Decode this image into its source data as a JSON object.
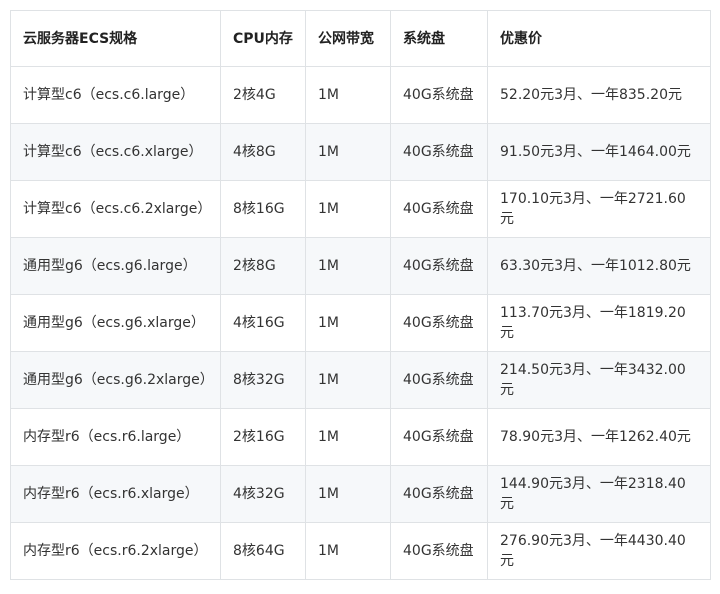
{
  "headers": [
    "云服务器ECS规格",
    "CPU内存",
    "公网带宽",
    "系统盘",
    "优惠价"
  ],
  "rows": [
    [
      "计算型c6（ecs.c6.large）",
      "2核4G",
      "1M",
      "40G系统盘",
      "52.20元3月、一年835.20元"
    ],
    [
      "计算型c6（ecs.c6.xlarge）",
      "4核8G",
      "1M",
      "40G系统盘",
      "91.50元3月、一年1464.00元"
    ],
    [
      "计算型c6（ecs.c6.2xlarge）",
      "8核16G",
      "1M",
      "40G系统盘",
      "170.10元3月、一年2721.60元"
    ],
    [
      "通用型g6（ecs.g6.large）",
      "2核8G",
      "1M",
      "40G系统盘",
      "63.30元3月、一年1012.80元"
    ],
    [
      "通用型g6（ecs.g6.xlarge）",
      "4核16G",
      "1M",
      "40G系统盘",
      "113.70元3月、一年1819.20元"
    ],
    [
      "通用型g6（ecs.g6.2xlarge）",
      "8核32G",
      "1M",
      "40G系统盘",
      "214.50元3月、一年3432.00元"
    ],
    [
      "内存型r6（ecs.r6.large）",
      "2核16G",
      "1M",
      "40G系统盘",
      "78.90元3月、一年1262.40元"
    ],
    [
      "内存型r6（ecs.r6.xlarge）",
      "4核32G",
      "1M",
      "40G系统盘",
      "144.90元3月、一年2318.40元"
    ],
    [
      "内存型r6（ecs.r6.2xlarge）",
      "8核64G",
      "1M",
      "40G系统盘",
      "276.90元3月、一年4430.40元"
    ]
  ]
}
